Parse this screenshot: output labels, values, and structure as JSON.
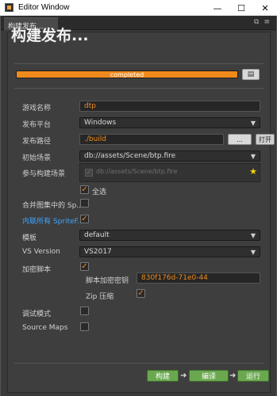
{
  "window": {
    "title": "Editor Window",
    "minimize": "—",
    "maximize": "☐",
    "close": "✕"
  },
  "tab": {
    "label": "构建发布...",
    "tools": [
      "⧉",
      "≡"
    ]
  },
  "page_title": "构建发布...",
  "progress": {
    "text": "completed",
    "value": 1.0
  },
  "form": {
    "game_name": {
      "label": "游戏名称",
      "value": "dtp"
    },
    "platform": {
      "label": "发布平台",
      "value": "Windows"
    },
    "build_path": {
      "label": "发布路径",
      "value": "./build",
      "browse": "...",
      "open": "打开"
    },
    "start_scene": {
      "label": "初始场景",
      "value": "db://assets/Scene/btp.fire"
    },
    "scenes": {
      "label": "参与构建场景",
      "items": [
        "db://assets/Scene/btp.fire"
      ],
      "select_all": "全选"
    },
    "merge_atlas": {
      "label": "合并图集中的 Sp..."
    },
    "inline_sprite": {
      "label": "内联所有 SpriteF..."
    },
    "template": {
      "label": "模板",
      "value": "default"
    },
    "vs_version": {
      "label": "VS Version",
      "value": "VS2017"
    },
    "encrypt": {
      "label": "加密脚本",
      "key_label": "脚本加密密钥",
      "key_value": "830f176d-71e0-44",
      "zip_label": "Zip 压缩"
    },
    "debug": {
      "label": "调试模式"
    },
    "source_maps": {
      "label": "Source Maps"
    }
  },
  "actions": {
    "build": "构建",
    "compile": "编译",
    "run": "运行",
    "arrow": "➜"
  },
  "colors": {
    "accent": "#f08a1c",
    "button_green": "#6aa84f",
    "link": "#3ea5ff"
  }
}
